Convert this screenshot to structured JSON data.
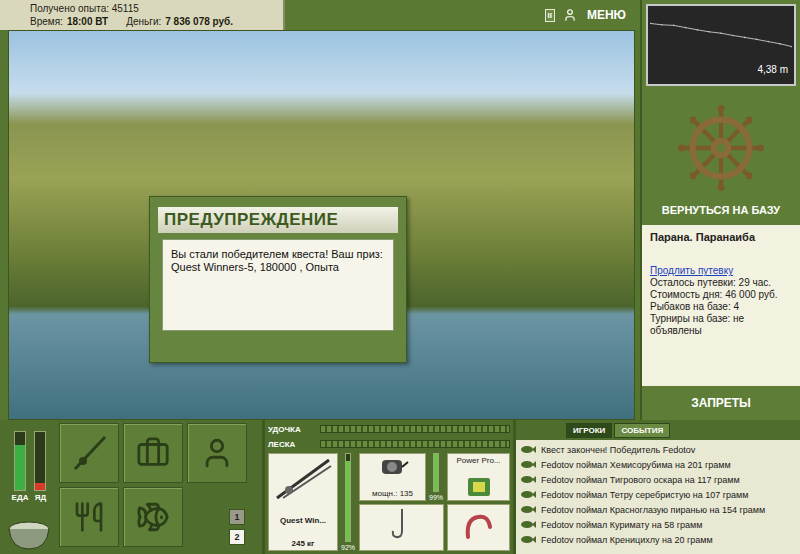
{
  "header": {
    "experience": "Получено опыта: 45115",
    "time_label": "Время:",
    "time": "18:00 ВТ",
    "money_label": "Деньги:",
    "money": "7 836 078 руб."
  },
  "toolbar": {
    "pause": "II",
    "menu": "МЕНЮ"
  },
  "dialog": {
    "title": "ПРЕДУПРЕЖДЕНИЕ",
    "message": "Вы стали победителем квеста! Ваш приз: Quest Winners-5, 180000 , Опыта"
  },
  "depth_chart": {
    "values": [
      3.55,
      3.6,
      3.62,
      3.7,
      3.78,
      3.85,
      3.9,
      3.98,
      4.05,
      4.12,
      4.2,
      4.28,
      4.38
    ],
    "reading": "4,38 m"
  },
  "base": {
    "return_button": "ВЕРНУТЬСЯ НА БАЗУ",
    "location": "Парана. Паранаиба",
    "extend_link": "Продлить путевку",
    "details": [
      "Осталось путевки: 29 час.",
      "Стоимость дня: 46 000 руб.",
      "Рыбаков на базе: 4",
      "Турниры на базе: не объявлены"
    ],
    "bans_button": "ЗАПРЕТЫ"
  },
  "meters": [
    {
      "label": "ЕДА",
      "level": 0.78,
      "color": "#3cb043"
    },
    {
      "label": "ЯД",
      "level": 0.12,
      "color": "#d83a2a"
    }
  ],
  "page_buttons": [
    {
      "label": "1",
      "selected": false
    },
    {
      "label": "2",
      "selected": true
    }
  ],
  "tackle": {
    "bars": [
      {
        "label": "УДОЧКА",
        "level": 0
      },
      {
        "label": "ЛЕСКА",
        "level": 0
      }
    ],
    "rod": {
      "name": "Quest Win...",
      "weight": "245 кг",
      "level": 0.92,
      "reading": "92%"
    },
    "reel": {
      "name": "мощн.: 135",
      "level": 0.99,
      "reading": "99%"
    },
    "line": {
      "name": "Power Pro..."
    }
  },
  "chat": {
    "tabs": [
      {
        "label": "ИГРОКИ",
        "selected": true
      },
      {
        "label": "СОБЫТИЯ",
        "selected": false
      }
    ],
    "messages": [
      "Квест закончен! Победитель Fedotov",
      "Fedotov поймал Хемисорубима на 201 грамм",
      "Fedotov поймал Тигрового оскара на 117 грамм",
      "Fedotov поймал Тетру серебристую на 107 грамм",
      "Fedotov поймал Красноглазую пиранью на 154 грамм",
      "Fedotov поймал Куримату на 58 грамм",
      "Fedotov поймал Креницихлу на 20 грамм"
    ]
  }
}
